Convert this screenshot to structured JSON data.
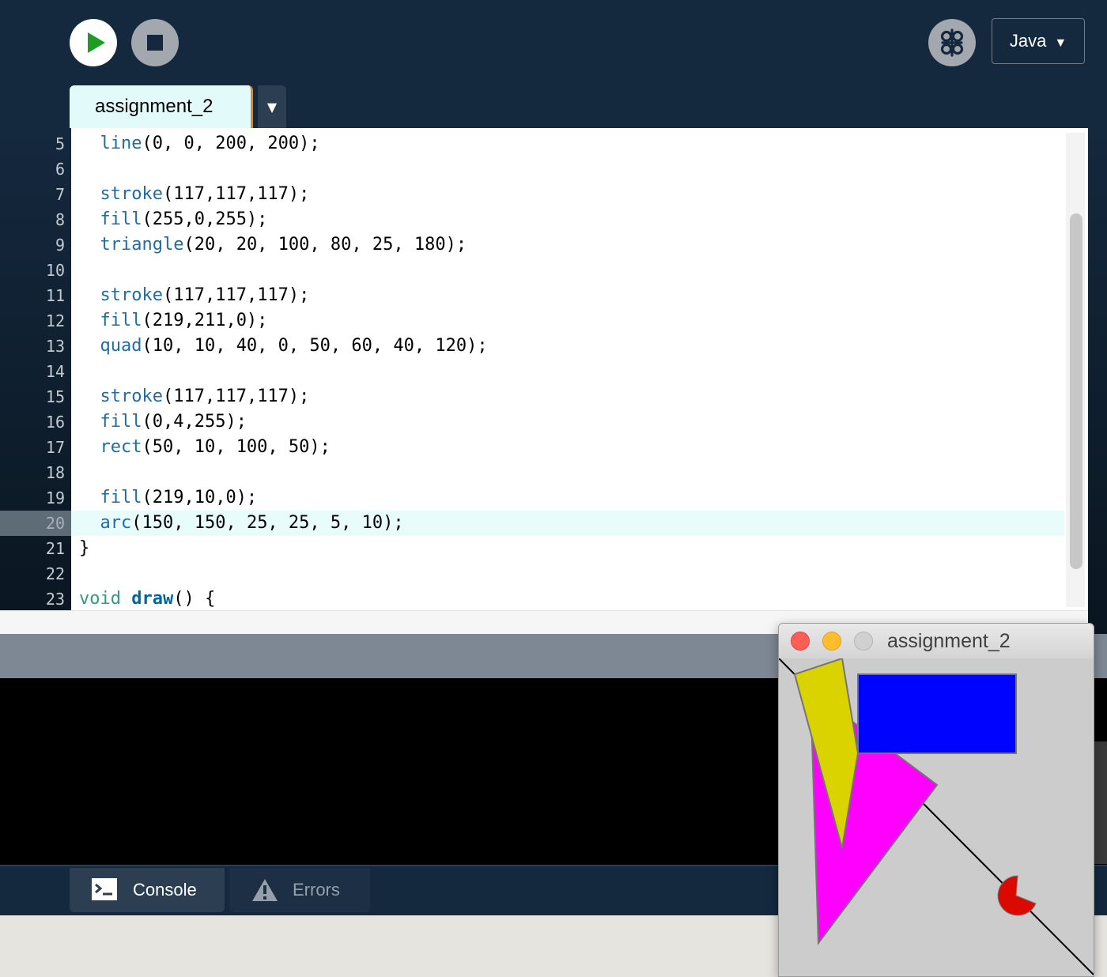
{
  "toolbar": {
    "run_label": "Run",
    "stop_label": "Stop",
    "debug_label": "Debugger",
    "mode": "Java",
    "mode_arrow": "▼"
  },
  "tabs": {
    "active": "assignment_2",
    "menu_arrow": "▼"
  },
  "editor": {
    "active_line": 20,
    "lines": [
      {
        "n": "5",
        "text": "line(0, 0, 200, 200);"
      },
      {
        "n": "6",
        "text": ""
      },
      {
        "n": "7",
        "text": "stroke(117,117,117);"
      },
      {
        "n": "8",
        "text": "fill(255,0,255);"
      },
      {
        "n": "9",
        "text": "triangle(20, 20, 100, 80, 25, 180);"
      },
      {
        "n": "10",
        "text": ""
      },
      {
        "n": "11",
        "text": "stroke(117,117,117);"
      },
      {
        "n": "12",
        "text": "fill(219,211,0);"
      },
      {
        "n": "13",
        "text": "quad(10, 10, 40, 0, 50, 60, 40, 120);"
      },
      {
        "n": "14",
        "text": ""
      },
      {
        "n": "15",
        "text": "stroke(117,117,117);"
      },
      {
        "n": "16",
        "text": "fill(0,4,255);"
      },
      {
        "n": "17",
        "text": "rect(50, 10, 100, 50);"
      },
      {
        "n": "18",
        "text": ""
      },
      {
        "n": "19",
        "text": "fill(219,10,0);"
      },
      {
        "n": "20",
        "text": "arc(150, 150, 25, 25, 5, 10);"
      },
      {
        "n": "21",
        "text": "}"
      },
      {
        "n": "22",
        "text": ""
      },
      {
        "n": "23",
        "text": "void draw() {"
      }
    ]
  },
  "footer": {
    "console_label": "Console",
    "errors_label": "Errors"
  },
  "sketch_window": {
    "title": "assignment_2"
  },
  "colors": {
    "toolbar_bg": "#14283e",
    "run_triangle": "#1e9c24",
    "tab_active_bg": "#e3fafb",
    "tab_accent": "#e1882b",
    "function_blue": "#216ca1",
    "keyword_green": "#33997e",
    "magenta_fill": "#ff00ff",
    "yellow_fill": "#dbd300",
    "blue_fill": "#0004ff",
    "red_fill": "#db0a00",
    "stroke_gray": "#757575"
  }
}
